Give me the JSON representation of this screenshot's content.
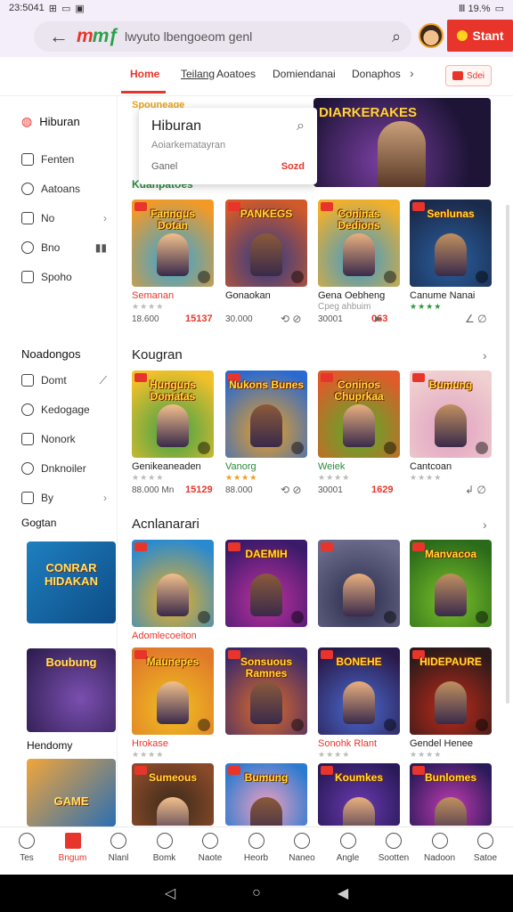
{
  "status": {
    "time": "23:5041",
    "icons": [
      "⊞",
      "▭",
      "▣"
    ],
    "right": "Ⅲ 19.%",
    "battery_icon": "▭"
  },
  "header": {
    "logo": "mƒ",
    "search_text": "lwyuto lbengoeom genl",
    "start_label": "Stant",
    "colors": {
      "accent": "#e8352b",
      "start": "#e8352b"
    }
  },
  "tabs": [
    {
      "label": "Home",
      "active": true
    },
    {
      "label": "Teilang",
      "active": false
    },
    {
      "label": "Aoatoes",
      "active": false
    },
    {
      "label": "Domiendanai",
      "active": false
    },
    {
      "label": "Donaphos",
      "active": false
    }
  ],
  "tabs_chevron": "›",
  "tabs_badge": "Sdei",
  "sidebar": {
    "top": {
      "label": "Hiburan"
    },
    "items1": [
      {
        "label": "Fenten",
        "icon": "share-icon"
      },
      {
        "label": "Aatoans",
        "icon": "chat-icon"
      },
      {
        "label": "No",
        "icon": "message-icon",
        "chev": "›"
      },
      {
        "label": "Bno",
        "icon": "bookmark-icon",
        "extra": "▮▮"
      },
      {
        "label": "Spoho",
        "icon": "refresh-icon"
      }
    ],
    "section2": "Noadongos",
    "items2": [
      {
        "label": "Domt",
        "icon": "calendar-icon",
        "extra": "⟋"
      },
      {
        "label": "Kedogage",
        "icon": "map-icon"
      },
      {
        "label": "Nonork",
        "icon": "folder-icon"
      },
      {
        "label": "Dnknoiler",
        "icon": "monitor-icon"
      },
      {
        "label": "By",
        "icon": "info-icon",
        "chev": "›"
      }
    ],
    "section3": "Gogtan",
    "card1_title": "CONRAR HIDAKAN",
    "card2_title": "Boubung",
    "card2_caption": "Hendomy",
    "card3_title": "GAME"
  },
  "popup": {
    "title": "Hiburan",
    "subtitle": "Aoiarkematayran",
    "game_label": "Ganel",
    "price": "Sozd",
    "search_icon": "⌕"
  },
  "featured": {
    "title": "DIARKERAKES",
    "above_label": "Spouneage",
    "below_label": "Kuanpatoes"
  },
  "sections": [
    {
      "heading": "",
      "cards": [
        {
          "title": "Fanngus Dotan",
          "name": "Semanan",
          "name_color": "red",
          "num": "18.600",
          "price": "15137",
          "stars": "★★★★",
          "star_color": "grey",
          "action": ""
        },
        {
          "title": "PANKEGS",
          "name": "Gonaokan",
          "name_color": "",
          "num": "30.000",
          "price": "",
          "stars": "",
          "star_color": "",
          "action": "⟲ ⊘"
        },
        {
          "title": "Coninas Dedions",
          "name": "Gena Oebheng",
          "name_color": "",
          "num": "30001",
          "price": "063",
          "stars": "",
          "sub": "Cpeg ahbuim",
          "star_color": "",
          "action": "➤"
        },
        {
          "title": "Senlunas",
          "name": "Canume Nanai",
          "name_color": "",
          "num": "",
          "price": "",
          "stars": "★★★★",
          "star_color": "green",
          "action": "∠ ∅"
        }
      ]
    },
    {
      "heading": "Kougran",
      "cards": [
        {
          "title": "Hunguns Domatas",
          "name": "Genikeaneaden",
          "name_color": "",
          "num": "88.000 Mn",
          "price": "15129",
          "stars": "★★★★",
          "star_color": "grey",
          "action": ""
        },
        {
          "title": "Nukons Bunes",
          "name": "Vanorg",
          "name_color": "green",
          "num": "88.000",
          "price": "",
          "stars": "★★★★",
          "star_color": "orange",
          "action": "⟲ ⊘"
        },
        {
          "title": "Coninos Chuprkaa",
          "name": "Weiek",
          "name_color": "green",
          "num": "30001",
          "price": "1629",
          "stars": "★★★★",
          "star_color": "grey",
          "action": ""
        },
        {
          "title": "Bumung",
          "name": "Cantcoan",
          "name_color": "",
          "num": "",
          "price": "",
          "stars": "★★★★",
          "star_color": "grey",
          "action": "↲ ∅"
        }
      ]
    },
    {
      "heading": "Acnlanarari",
      "cards": [
        {
          "title": "",
          "name": "Adomlecoeiton",
          "name_color": "red",
          "num": "",
          "price": "",
          "stars": "",
          "star_color": "",
          "action": ""
        },
        {
          "title": "DAEMIH",
          "name": "",
          "name_color": "",
          "num": "",
          "price": "",
          "stars": "",
          "star_color": "",
          "action": ""
        },
        {
          "title": "",
          "name": "",
          "name_color": "",
          "num": "",
          "price": "",
          "stars": "",
          "star_color": "",
          "action": ""
        },
        {
          "title": "Manvacoa",
          "name": "",
          "name_color": "",
          "num": "",
          "price": "",
          "stars": "",
          "star_color": "",
          "action": ""
        }
      ]
    },
    {
      "heading": "",
      "cards": [
        {
          "title": "Maunepes",
          "name": "Hrokase",
          "name_color": "red",
          "num": "",
          "price": "",
          "stars": "★★★★",
          "star_color": "grey",
          "action": ""
        },
        {
          "title": "Sonsuous Ramnes",
          "name": "",
          "name_color": "",
          "num": "",
          "price": "",
          "stars": "",
          "star_color": "",
          "action": ""
        },
        {
          "title": "BONEHE",
          "name": "Sonohk Rlant",
          "name_color": "red",
          "num": "",
          "price": "",
          "stars": "★★★★",
          "star_color": "grey",
          "action": ""
        },
        {
          "title": "HIDEPAURE",
          "name": "Gendel Henee",
          "name_color": "",
          "num": "",
          "price": "",
          "stars": "★★★★",
          "star_color": "grey",
          "action": ""
        }
      ]
    },
    {
      "heading": "",
      "cards": [
        {
          "title": "Sumeous",
          "name": "",
          "name_color": "",
          "num": "",
          "price": "",
          "stars": "",
          "star_color": "",
          "action": ""
        },
        {
          "title": "Bumung",
          "name": "",
          "name_color": "",
          "num": "",
          "price": "",
          "stars": "",
          "star_color": "",
          "action": ""
        },
        {
          "title": "Koumkes",
          "name": "",
          "name_color": "",
          "num": "",
          "price": "",
          "stars": "",
          "star_color": "",
          "action": ""
        },
        {
          "title": "Bunlomes",
          "name": "",
          "name_color": "",
          "num": "",
          "price": "",
          "stars": "",
          "star_color": "",
          "action": ""
        }
      ]
    }
  ],
  "section_chevron": "›",
  "bottom_nav": [
    {
      "label": "Tes",
      "icon": "bolt-icon"
    },
    {
      "label": "Bngum",
      "icon": "home-icon",
      "active": true
    },
    {
      "label": "Nlanl",
      "icon": "puzzle-icon"
    },
    {
      "label": "Bomk",
      "icon": "user-icon"
    },
    {
      "label": "Naote",
      "icon": "search-icon"
    },
    {
      "label": "Heorb",
      "icon": "bell-icon"
    },
    {
      "label": "Naneo",
      "icon": "mail-icon"
    },
    {
      "label": "Angle",
      "icon": "globe-icon"
    },
    {
      "label": "Sootten",
      "icon": "people-icon"
    },
    {
      "label": "Nadoon",
      "icon": "person-icon"
    },
    {
      "label": "Satoe",
      "icon": "settings-icon"
    }
  ],
  "sysnav": {
    "back": "◁",
    "home": "○",
    "recent": "◀"
  }
}
